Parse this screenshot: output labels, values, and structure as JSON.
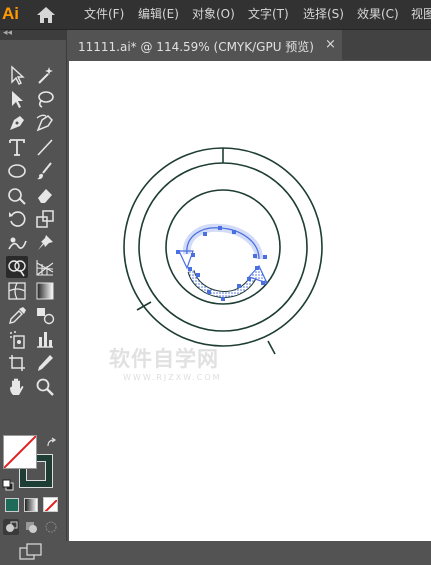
{
  "app": {
    "logo": "Ai",
    "home_icon": "home-icon"
  },
  "menu": [
    "文件(F)",
    "编辑(E)",
    "对象(O)",
    "文字(T)",
    "选择(S)",
    "效果(C)",
    "视图"
  ],
  "tab": {
    "title": "11111.ai* @ 114.59% (CMYK/GPU 预览)",
    "close": "×"
  },
  "toolbar": {
    "collapse": "◂◂",
    "tools": [
      "selection-tool",
      "magic-wand-tool",
      "direct-selection-tool",
      "lasso-tool",
      "pen-tool",
      "curvature-tool",
      "type-tool",
      "line-segment-tool",
      "ellipse-tool",
      "paintbrush-tool",
      "shaper-tool",
      "eraser-tool",
      "rotate-tool",
      "scale-tool",
      "puppet-warp-tool",
      "pin-tool",
      "shape-builder-tool",
      "perspective-grid-tool",
      "mesh-tool",
      "gradient-tool",
      "eyedropper-tool",
      "blend-tool",
      "symbol-sprayer-tool",
      "graph-tool",
      "artboard-tool",
      "slice-tool",
      "hand-tool",
      "zoom-tool"
    ]
  },
  "colors": {
    "stroke": "#1e3d34",
    "selection": "#4a6fe0",
    "fill_none_slash": "#e0201f"
  },
  "watermark": {
    "main": "软件自学网",
    "sub": "WWW.RJZXW.COM"
  }
}
